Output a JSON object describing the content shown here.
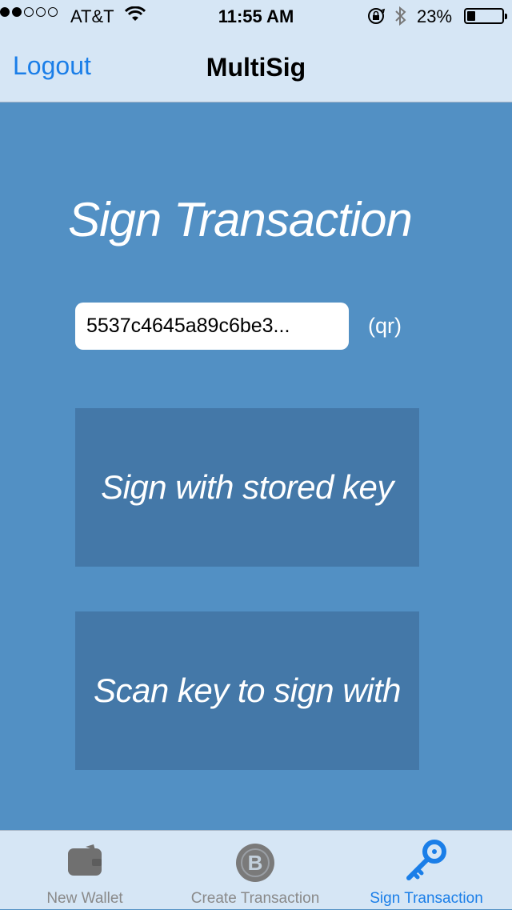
{
  "status_bar": {
    "carrier": "AT&T",
    "time": "11:55 AM",
    "battery_percent": "23%",
    "battery_level": 0.23,
    "signal_bars_filled": 2,
    "signal_bars_total": 5
  },
  "nav": {
    "left_button": "Logout",
    "title": "MultiSig"
  },
  "main": {
    "heading": "Sign Transaction",
    "tx_input_value": "5537c4645a89c6be3...",
    "qr_link": "(qr)",
    "sign_stored_label": "Sign with stored key",
    "scan_key_label": "Scan key to sign with"
  },
  "tabs": [
    {
      "label": "New Wallet",
      "icon": "wallet-icon",
      "active": false
    },
    {
      "label": "Create Transaction",
      "icon": "bitcoin-icon",
      "active": false
    },
    {
      "label": "Sign Transaction",
      "icon": "key-icon",
      "active": true
    }
  ],
  "colors": {
    "background": "#5290c4",
    "bar": "#d6e6f5",
    "button": "#4478a8",
    "accent": "#1a7ee8",
    "inactive_tab": "#8a8a8a"
  }
}
